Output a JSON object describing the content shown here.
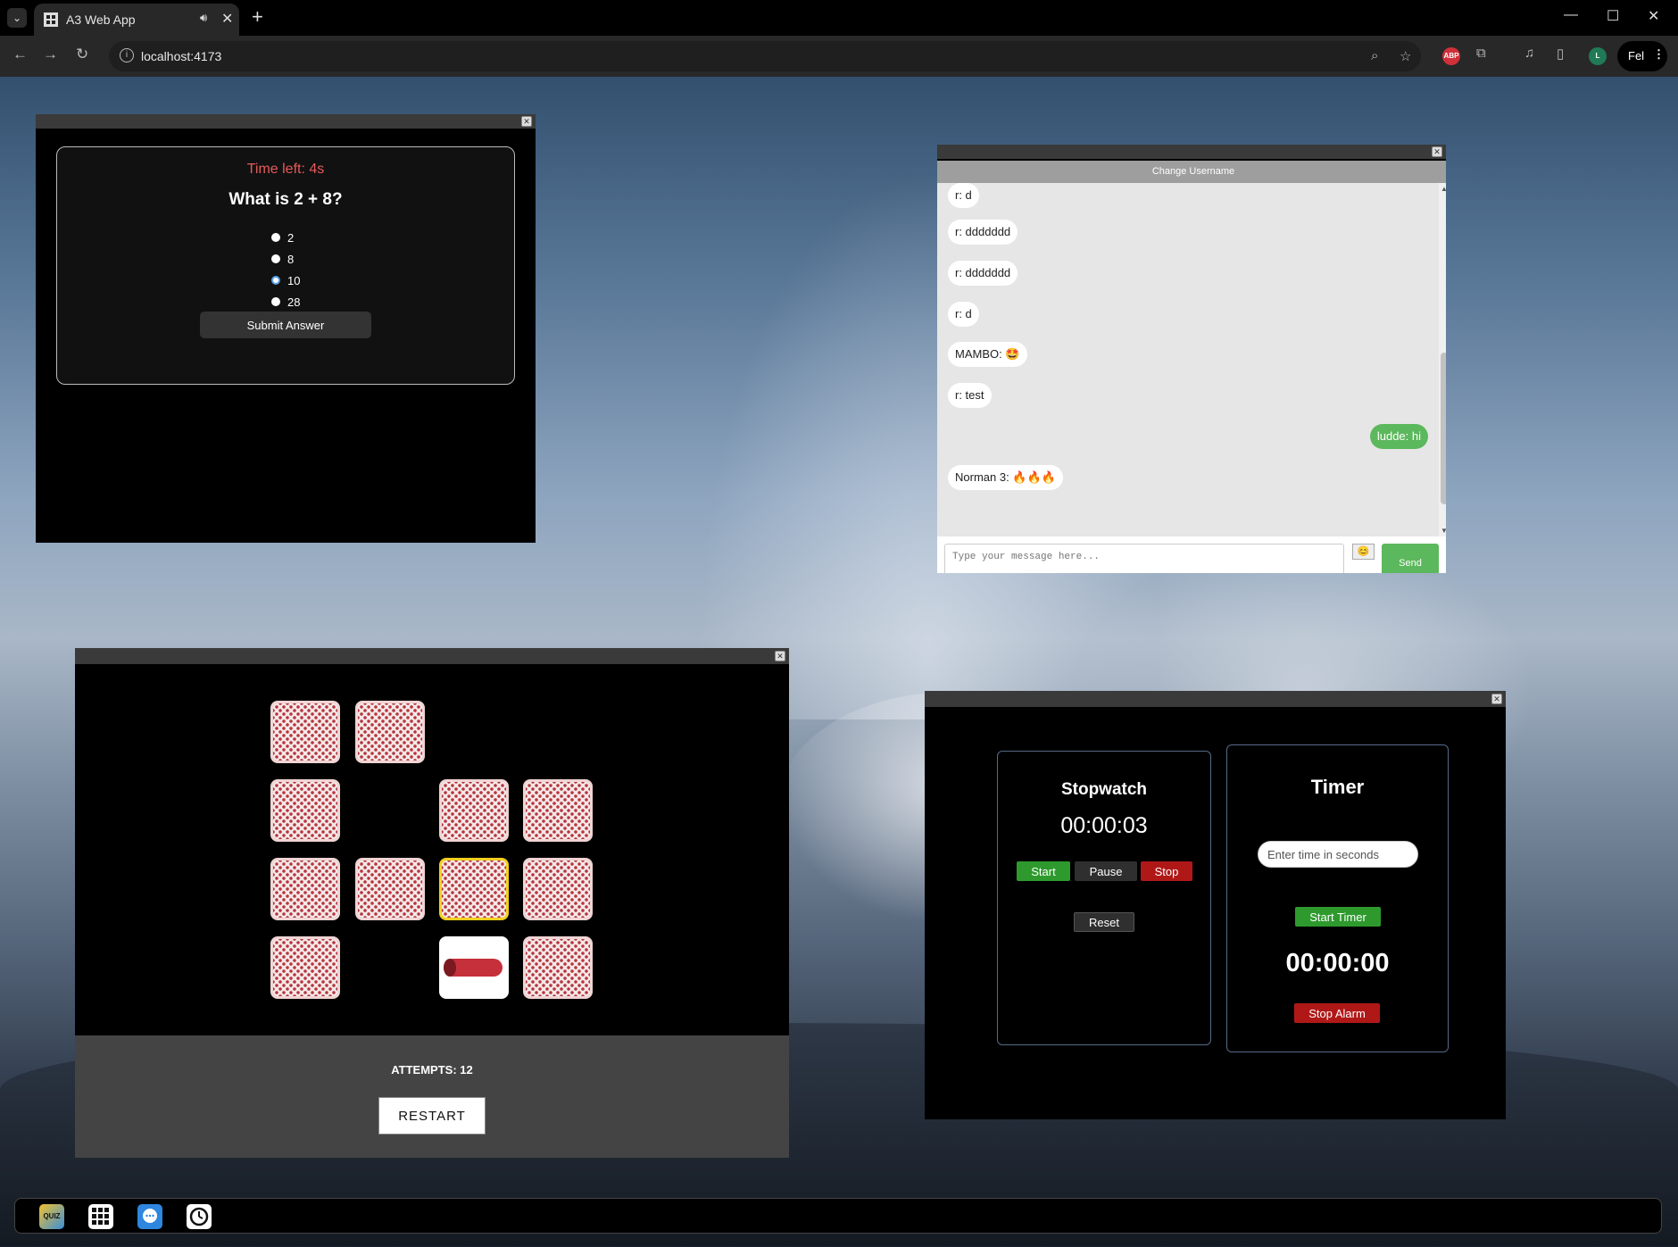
{
  "browser": {
    "tab_title": "A3 Web App",
    "url": "localhost:4173",
    "profile_label": "Fel",
    "avatar_letter": "L",
    "adblock_label": "ABP"
  },
  "quiz": {
    "time_left": "Time left: 4s",
    "question": "What is 2 + 8?",
    "options": [
      "2",
      "8",
      "10",
      "28"
    ],
    "selected": "10",
    "submit_label": "Submit Answer"
  },
  "chat": {
    "change_username_label": "Change Username",
    "messages": [
      {
        "text": "r: d",
        "mine": false
      },
      {
        "text": "r: ddddddd",
        "mine": false
      },
      {
        "text": "r: ddddddd",
        "mine": false
      },
      {
        "text": "r: d",
        "mine": false
      },
      {
        "text": "MAMBO: 🤩",
        "mine": false
      },
      {
        "text": "r: test",
        "mine": false
      },
      {
        "text": "ludde: hi",
        "mine": true
      },
      {
        "text": "Norman 3: 🔥🔥🔥",
        "mine": false
      }
    ],
    "input_placeholder": "Type your message here...",
    "emoji_button": "😊",
    "send_label": "Send"
  },
  "memory": {
    "attempts_label": "ATTEMPTS: 12",
    "restart_label": "RESTART"
  },
  "stopwatch": {
    "title": "Stopwatch",
    "time": "00:00:03",
    "start_label": "Start",
    "pause_label": "Pause",
    "stop_label": "Stop",
    "reset_label": "Reset"
  },
  "timer": {
    "title": "Timer",
    "input_placeholder": "Enter time in seconds",
    "start_label": "Start Timer",
    "time": "00:00:00",
    "stop_alarm_label": "Stop Alarm"
  },
  "colors": {
    "quiz_time_left": "#e65a5a",
    "chat_send": "#5cb85c",
    "stopwatch_start": "#2e9a2e",
    "stopwatch_stop": "#b01818",
    "card_pattern": "#b5363e",
    "card_focus": "#f2d020"
  },
  "taskbar": {
    "apps": [
      "quiz-app-icon",
      "memory-game-icon",
      "chat-app-icon",
      "clock-app-icon"
    ]
  }
}
